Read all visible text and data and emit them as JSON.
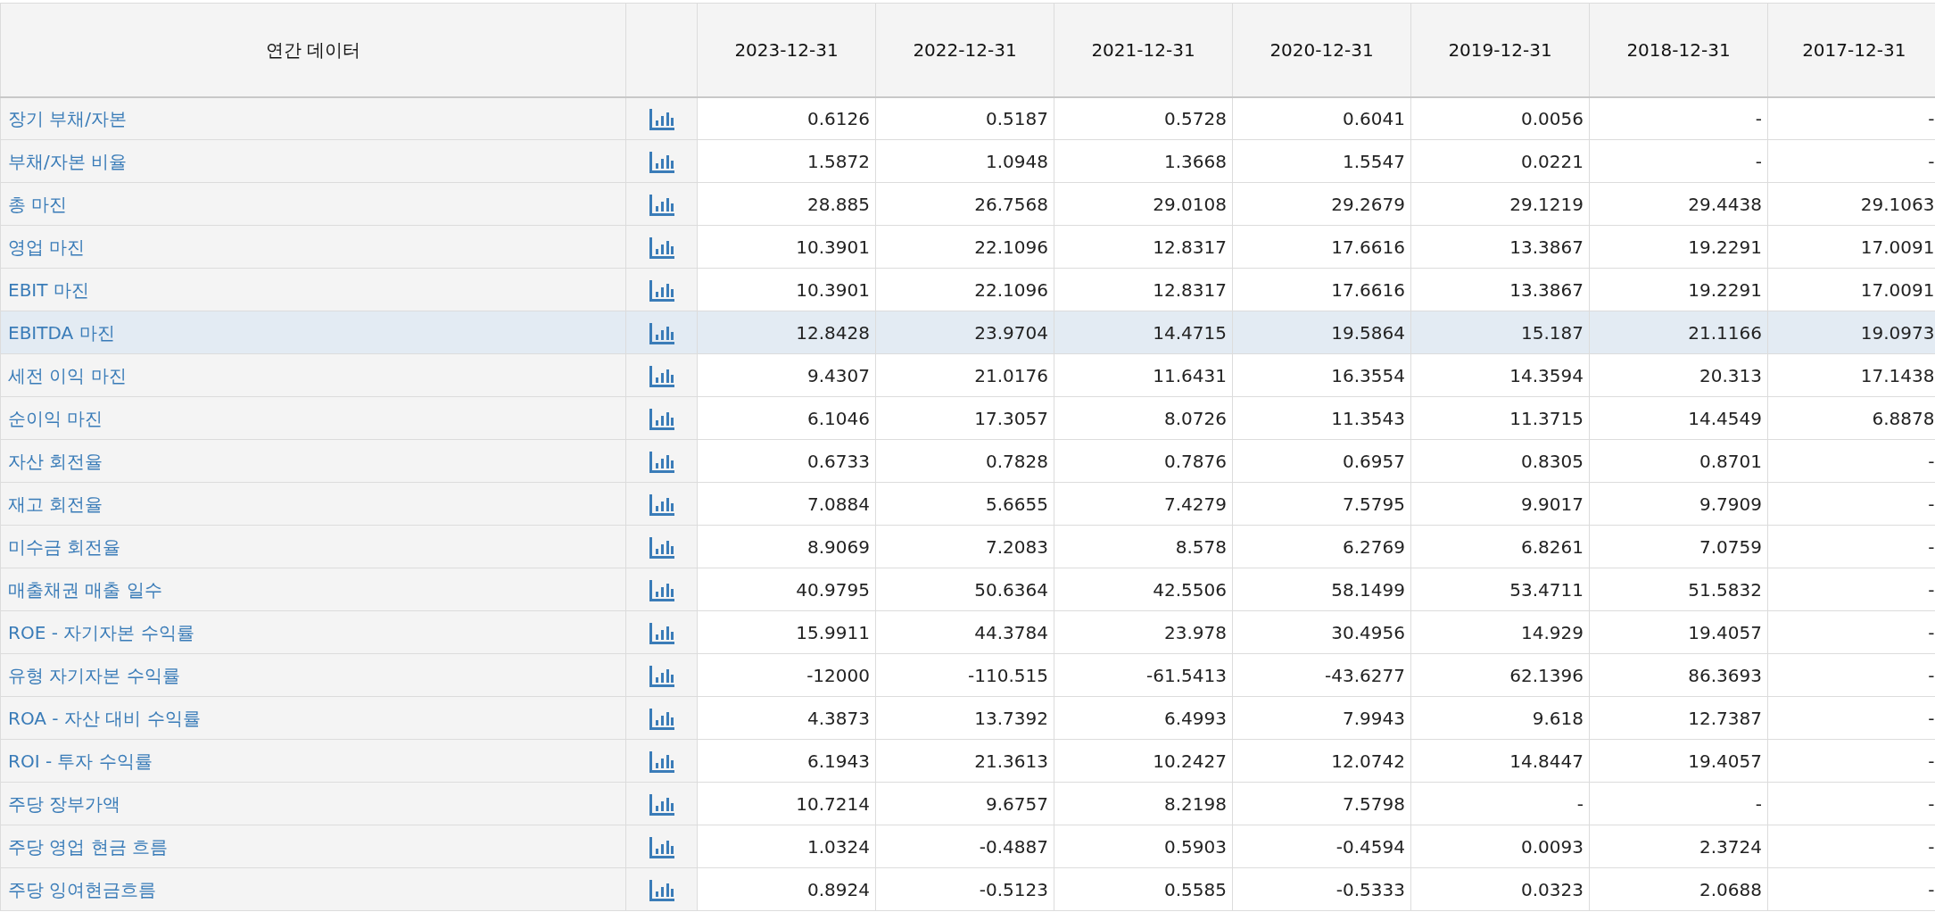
{
  "table": {
    "title": "연간 데이터",
    "columns": [
      "2023-12-31",
      "2022-12-31",
      "2021-12-31",
      "2020-12-31",
      "2019-12-31",
      "2018-12-31",
      "2017-12-31"
    ],
    "rows": [
      {
        "label": "장기 부채/자본",
        "selected": false,
        "values": [
          "0.6126",
          "0.5187",
          "0.5728",
          "0.6041",
          "0.0056",
          "-",
          "-"
        ]
      },
      {
        "label": "부채/자본 비율",
        "selected": false,
        "values": [
          "1.5872",
          "1.0948",
          "1.3668",
          "1.5547",
          "0.0221",
          "-",
          "-"
        ]
      },
      {
        "label": "총 마진",
        "selected": false,
        "values": [
          "28.885",
          "26.7568",
          "29.0108",
          "29.2679",
          "29.1219",
          "29.4438",
          "29.1063"
        ]
      },
      {
        "label": "영업 마진",
        "selected": false,
        "values": [
          "10.3901",
          "22.1096",
          "12.8317",
          "17.6616",
          "13.3867",
          "19.2291",
          "17.0091"
        ]
      },
      {
        "label": "EBIT 마진",
        "selected": false,
        "values": [
          "10.3901",
          "22.1096",
          "12.8317",
          "17.6616",
          "13.3867",
          "19.2291",
          "17.0091"
        ]
      },
      {
        "label": "EBITDA 마진",
        "selected": true,
        "values": [
          "12.8428",
          "23.9704",
          "14.4715",
          "19.5864",
          "15.187",
          "21.1166",
          "19.0973"
        ]
      },
      {
        "label": "세전 이익 마진",
        "selected": false,
        "values": [
          "9.4307",
          "21.0176",
          "11.6431",
          "16.3554",
          "14.3594",
          "20.313",
          "17.1438"
        ]
      },
      {
        "label": "순이익 마진",
        "selected": false,
        "values": [
          "6.1046",
          "17.3057",
          "8.0726",
          "11.3543",
          "11.3715",
          "14.4549",
          "6.8878"
        ]
      },
      {
        "label": "자산 회전율",
        "selected": false,
        "values": [
          "0.6733",
          "0.7828",
          "0.7876",
          "0.6957",
          "0.8305",
          "0.8701",
          "-"
        ]
      },
      {
        "label": "재고 회전율",
        "selected": false,
        "values": [
          "7.0884",
          "5.6655",
          "7.4279",
          "7.5795",
          "9.9017",
          "9.7909",
          "-"
        ]
      },
      {
        "label": "미수금 회전율",
        "selected": false,
        "values": [
          "8.9069",
          "7.2083",
          "8.578",
          "6.2769",
          "6.8261",
          "7.0759",
          "-"
        ]
      },
      {
        "label": "매출채권 매출 일수",
        "selected": false,
        "values": [
          "40.9795",
          "50.6364",
          "42.5506",
          "58.1499",
          "53.4711",
          "51.5832",
          "-"
        ]
      },
      {
        "label": "ROE - 자기자본 수익률",
        "selected": false,
        "values": [
          "15.9911",
          "44.3784",
          "23.978",
          "30.4956",
          "14.929",
          "19.4057",
          "-"
        ]
      },
      {
        "label": "유형 자기자본 수익률",
        "selected": false,
        "values": [
          "-12000",
          "-110.515",
          "-61.5413",
          "-43.6277",
          "62.1396",
          "86.3693",
          "-"
        ]
      },
      {
        "label": "ROA - 자산 대비 수익률",
        "selected": false,
        "values": [
          "4.3873",
          "13.7392",
          "6.4993",
          "7.9943",
          "9.618",
          "12.7387",
          "-"
        ]
      },
      {
        "label": "ROI - 투자 수익률",
        "selected": false,
        "values": [
          "6.1943",
          "21.3613",
          "10.2427",
          "12.0742",
          "14.8447",
          "19.4057",
          "-"
        ]
      },
      {
        "label": "주당 장부가액",
        "selected": false,
        "values": [
          "10.7214",
          "9.6757",
          "8.2198",
          "7.5798",
          "-",
          "-",
          "-"
        ]
      },
      {
        "label": "주당 영업 현금 흐름",
        "selected": false,
        "values": [
          "1.0324",
          "-0.4887",
          "0.5903",
          "-0.4594",
          "0.0093",
          "2.3724",
          "-"
        ]
      },
      {
        "label": "주당 잉여현금흐름",
        "selected": false,
        "values": [
          "0.8924",
          "-0.5123",
          "0.5585",
          "-0.5333",
          "0.0323",
          "2.0688",
          "-"
        ]
      }
    ]
  }
}
